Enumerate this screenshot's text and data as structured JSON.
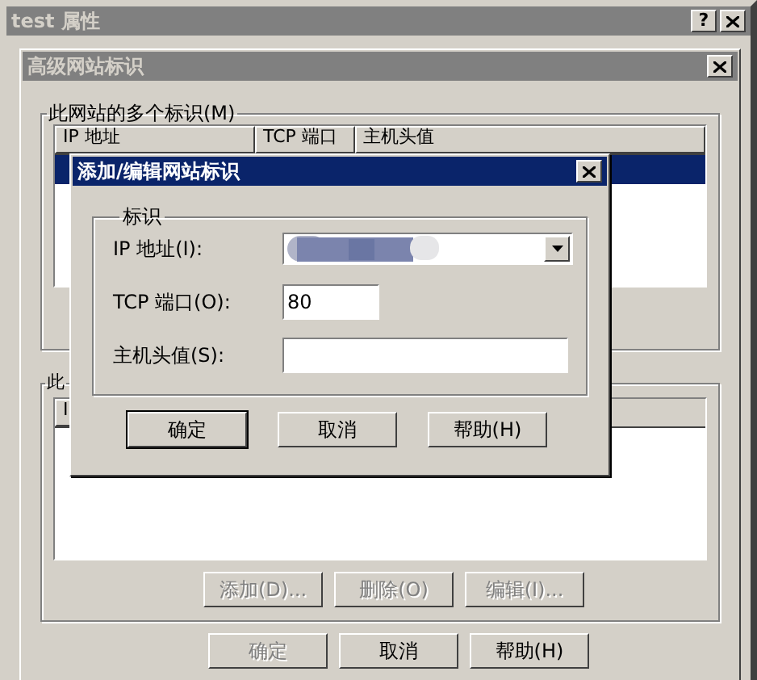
{
  "outer_window": {
    "title": "test 属性",
    "active": false,
    "help_button": "?"
  },
  "dialog": {
    "title": "高级网站标识",
    "active": false,
    "identities_group": {
      "label": "此网站的多个标识(M)",
      "columns": [
        "IP 地址",
        "TCP 端口",
        "主机头值"
      ],
      "rows": [
        {
          "selected": true
        }
      ]
    },
    "second_group": {
      "label": "此",
      "columns": [
        "I"
      ],
      "buttons": [
        {
          "label": "添加(D)...",
          "disabled": true
        },
        {
          "label": "删除(O)",
          "disabled": true
        },
        {
          "label": "编辑(I)...",
          "disabled": true
        }
      ]
    },
    "buttons": [
      {
        "label": "确定",
        "disabled": true
      },
      {
        "label": "取消",
        "disabled": false
      },
      {
        "label": "帮助(H)",
        "disabled": false
      }
    ]
  },
  "modal": {
    "title": "添加/编辑网站标识",
    "active": true,
    "group": "标识",
    "fields": [
      {
        "label": "IP 地址(I):",
        "kind": "dropdown"
      },
      {
        "label": "TCP 端口(O):",
        "kind": "number",
        "value": "80"
      },
      {
        "label": "主机头值(S):",
        "kind": "text"
      }
    ],
    "buttons": [
      {
        "label": "确定",
        "default": true
      },
      {
        "label": "取消",
        "default": false
      },
      {
        "label": "帮助(H)",
        "default": false
      }
    ]
  }
}
